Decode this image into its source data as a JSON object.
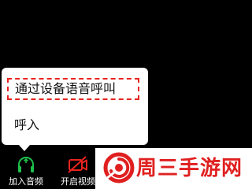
{
  "audio_menu": {
    "items": [
      {
        "label": "通过设备语音呼叫",
        "highlighted": true
      },
      {
        "label": "呼入",
        "highlighted": false
      }
    ],
    "highlight_color": "#e8241f"
  },
  "toolbar": {
    "join_audio": {
      "label": "加入音频",
      "icon": "headphones-icon",
      "icon_color": "#1fbf4a"
    },
    "start_video": {
      "label": "开启视频",
      "icon": "video-off-icon",
      "icon_color": "#e8241f"
    }
  },
  "watermark": {
    "text": "周三手游网",
    "color": "#e02020"
  }
}
